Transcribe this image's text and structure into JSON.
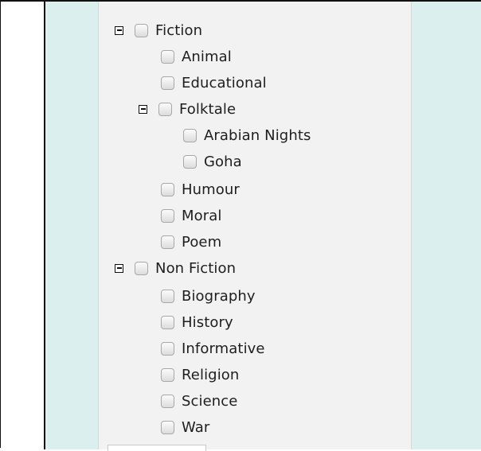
{
  "tree": {
    "fiction": {
      "label": "Fiction",
      "children": {
        "animal": "Animal",
        "educational": "Educational",
        "folktale": {
          "label": "Folktale",
          "children": {
            "arabian_nights": "Arabian Nights",
            "goha": "Goha"
          }
        },
        "humour": "Humour",
        "moral": "Moral",
        "poem": "Poem"
      }
    },
    "non_fiction": {
      "label": "Non Fiction",
      "children": {
        "biography": "Biography",
        "history": "History",
        "informative": "Informative",
        "religion": "Religion",
        "science": "Science",
        "war": "War"
      }
    }
  },
  "icons": {
    "expanded_toggle": "collapse-square-icon",
    "checkbox": "checkbox-unchecked"
  },
  "colors": {
    "panel_bg": "#f2f2f2",
    "side_bg": "#dcefef",
    "text": "#1e1e1e"
  }
}
